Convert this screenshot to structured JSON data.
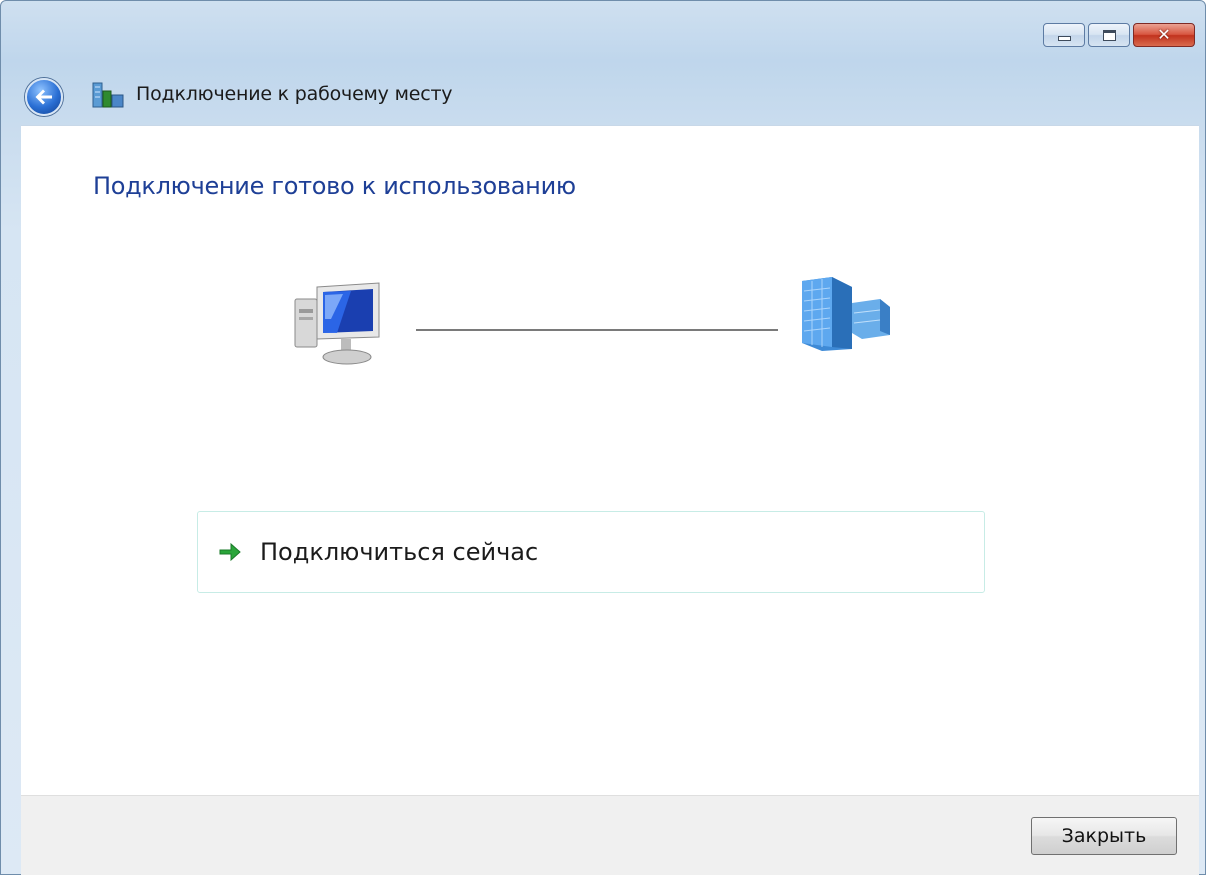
{
  "window": {
    "title": "Подключение к рабочему месту"
  },
  "controls": {
    "minimize_icon": "minimize-icon",
    "maximize_icon": "maximize-icon",
    "close_icon": "close-icon"
  },
  "main": {
    "heading": "Подключение готово к использованию",
    "computer_icon": "computer-icon",
    "workplace_icon": "office-building-icon",
    "connect_link": {
      "label": "Подключиться сейчас",
      "icon": "green-arrow-icon"
    }
  },
  "footer": {
    "close_label": "Закрыть"
  },
  "colors": {
    "heading": "#1e3f96",
    "link_border": "#c7ece6",
    "arrow": "#2aa53a",
    "close_button_red": "#c1321d"
  }
}
